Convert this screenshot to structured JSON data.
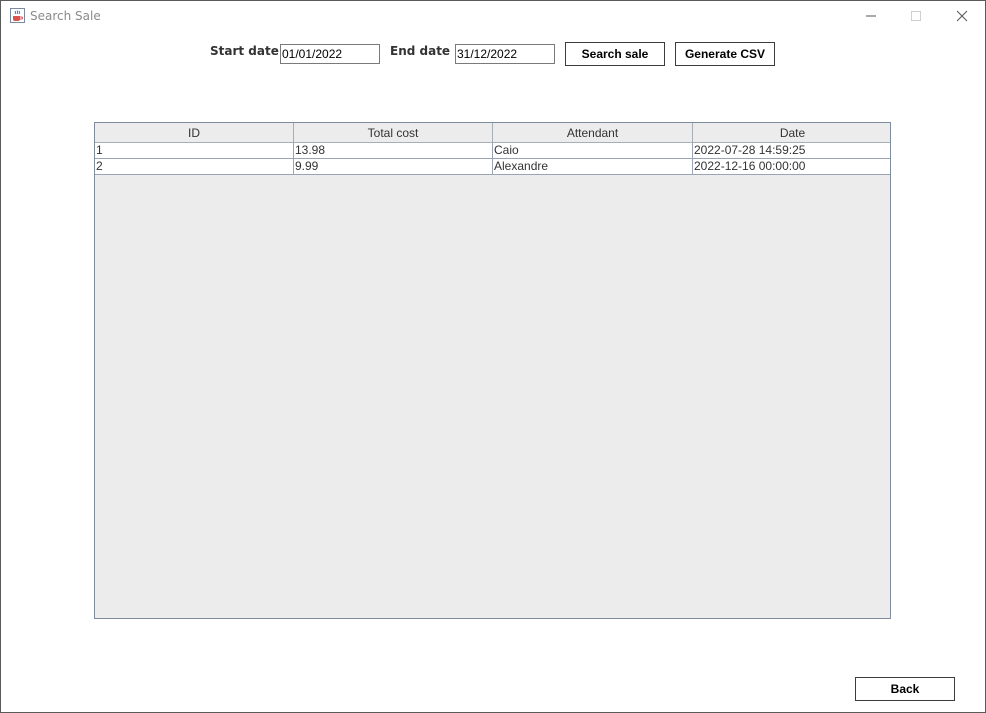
{
  "window": {
    "title": "Search Sale",
    "icon": "java-cup-icon"
  },
  "filters": {
    "start_date_label": "Start date",
    "start_date_value": "01/01/2022",
    "end_date_label": "End date",
    "end_date_value": "31/12/2022",
    "search_button_label": "Search sale",
    "csv_button_label": "Generate CSV"
  },
  "table": {
    "columns": [
      "ID",
      "Total cost",
      "Attendant",
      "Date"
    ],
    "rows": [
      [
        "1",
        "13.98",
        "Caio",
        "2022-07-28 14:59:25"
      ],
      [
        "2",
        "9.99",
        "Alexandre",
        "2022-12-16 00:00:00"
      ]
    ]
  },
  "footer": {
    "back_button_label": "Back"
  },
  "colors": {
    "table_background": "#ececec",
    "table_border": "#7f8c9b",
    "button_border": "#3c3c3c"
  }
}
